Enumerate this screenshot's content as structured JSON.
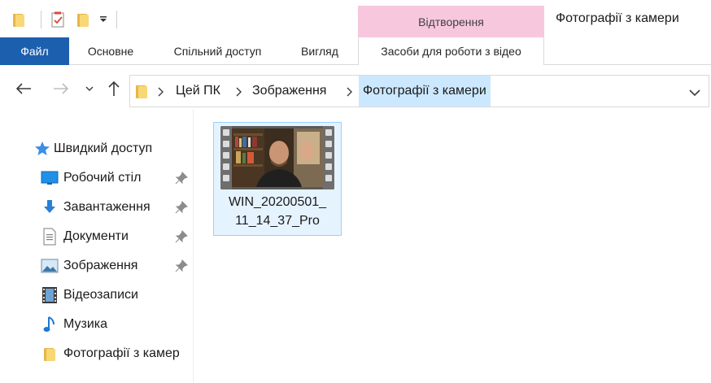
{
  "window": {
    "title": "Фотографії з камери"
  },
  "quick_access_toolbar": {
    "items": [
      "folder-icon",
      "properties-check-icon",
      "new-folder-icon",
      "customize-dropdown-icon"
    ]
  },
  "ribbon": {
    "context_group": "Відтворення",
    "tabs": {
      "file": "Файл",
      "home": "Основне",
      "share": "Спільний доступ",
      "view": "Вигляд",
      "video_tools": "Засоби для роботи з відео"
    }
  },
  "address_bar": {
    "breadcrumbs": [
      "Цей ПК",
      "Зображення",
      "Фотографії з камери"
    ]
  },
  "sidebar": {
    "quick_access": "Швидкий доступ",
    "items": [
      {
        "label": "Робочий стіл",
        "icon": "desktop-icon",
        "pinned": true
      },
      {
        "label": "Завантаження",
        "icon": "download-icon",
        "pinned": true
      },
      {
        "label": "Документи",
        "icon": "documents-icon",
        "pinned": true
      },
      {
        "label": "Зображення",
        "icon": "pictures-icon",
        "pinned": true
      },
      {
        "label": "Відеозаписи",
        "icon": "videos-icon",
        "pinned": false
      },
      {
        "label": "Музика",
        "icon": "music-icon",
        "pinned": false
      },
      {
        "label": "Фотографії з камер",
        "icon": "folder-icon",
        "pinned": false
      }
    ]
  },
  "content": {
    "files": [
      {
        "name_line1": "WIN_20200501_",
        "name_line2": "11_14_37_Pro",
        "type": "video"
      }
    ]
  },
  "colors": {
    "file_tab": "#1c5fae",
    "context_tab": "#f7c7de",
    "selection": "#e5f3ff",
    "selection_border": "#99d1ff",
    "active_crumb": "#cce8ff"
  }
}
